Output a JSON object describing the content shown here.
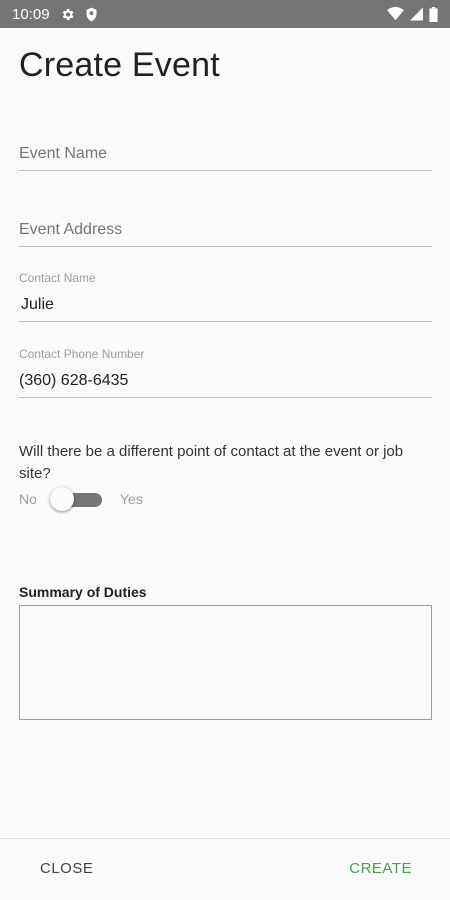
{
  "status_bar": {
    "time": "10:09",
    "icons": [
      "gear-icon",
      "shield-icon",
      "wifi-icon",
      "signal-icon",
      "battery-icon"
    ]
  },
  "page": {
    "title": "Create Event"
  },
  "form": {
    "event_name": {
      "placeholder": "Event Name",
      "value": ""
    },
    "event_address": {
      "placeholder": "Event Address",
      "value": ""
    },
    "contact_name": {
      "label": "Contact Name",
      "value": "Julie"
    },
    "contact_phone": {
      "label": "Contact Phone Number",
      "value": "(360) 628-6435"
    },
    "different_contact": {
      "question": "Will there be a different point of contact at the event or job site?",
      "off_label": "No",
      "on_label": "Yes",
      "checked": false
    },
    "summary": {
      "label": "Summary of Duties",
      "value": ""
    }
  },
  "actions": {
    "close_label": "CLOSE",
    "create_label": "CREATE"
  },
  "colors": {
    "status_bar": "#757575",
    "background": "#fafafa",
    "accent_create": "#43a047",
    "switch_track": "#757575"
  }
}
